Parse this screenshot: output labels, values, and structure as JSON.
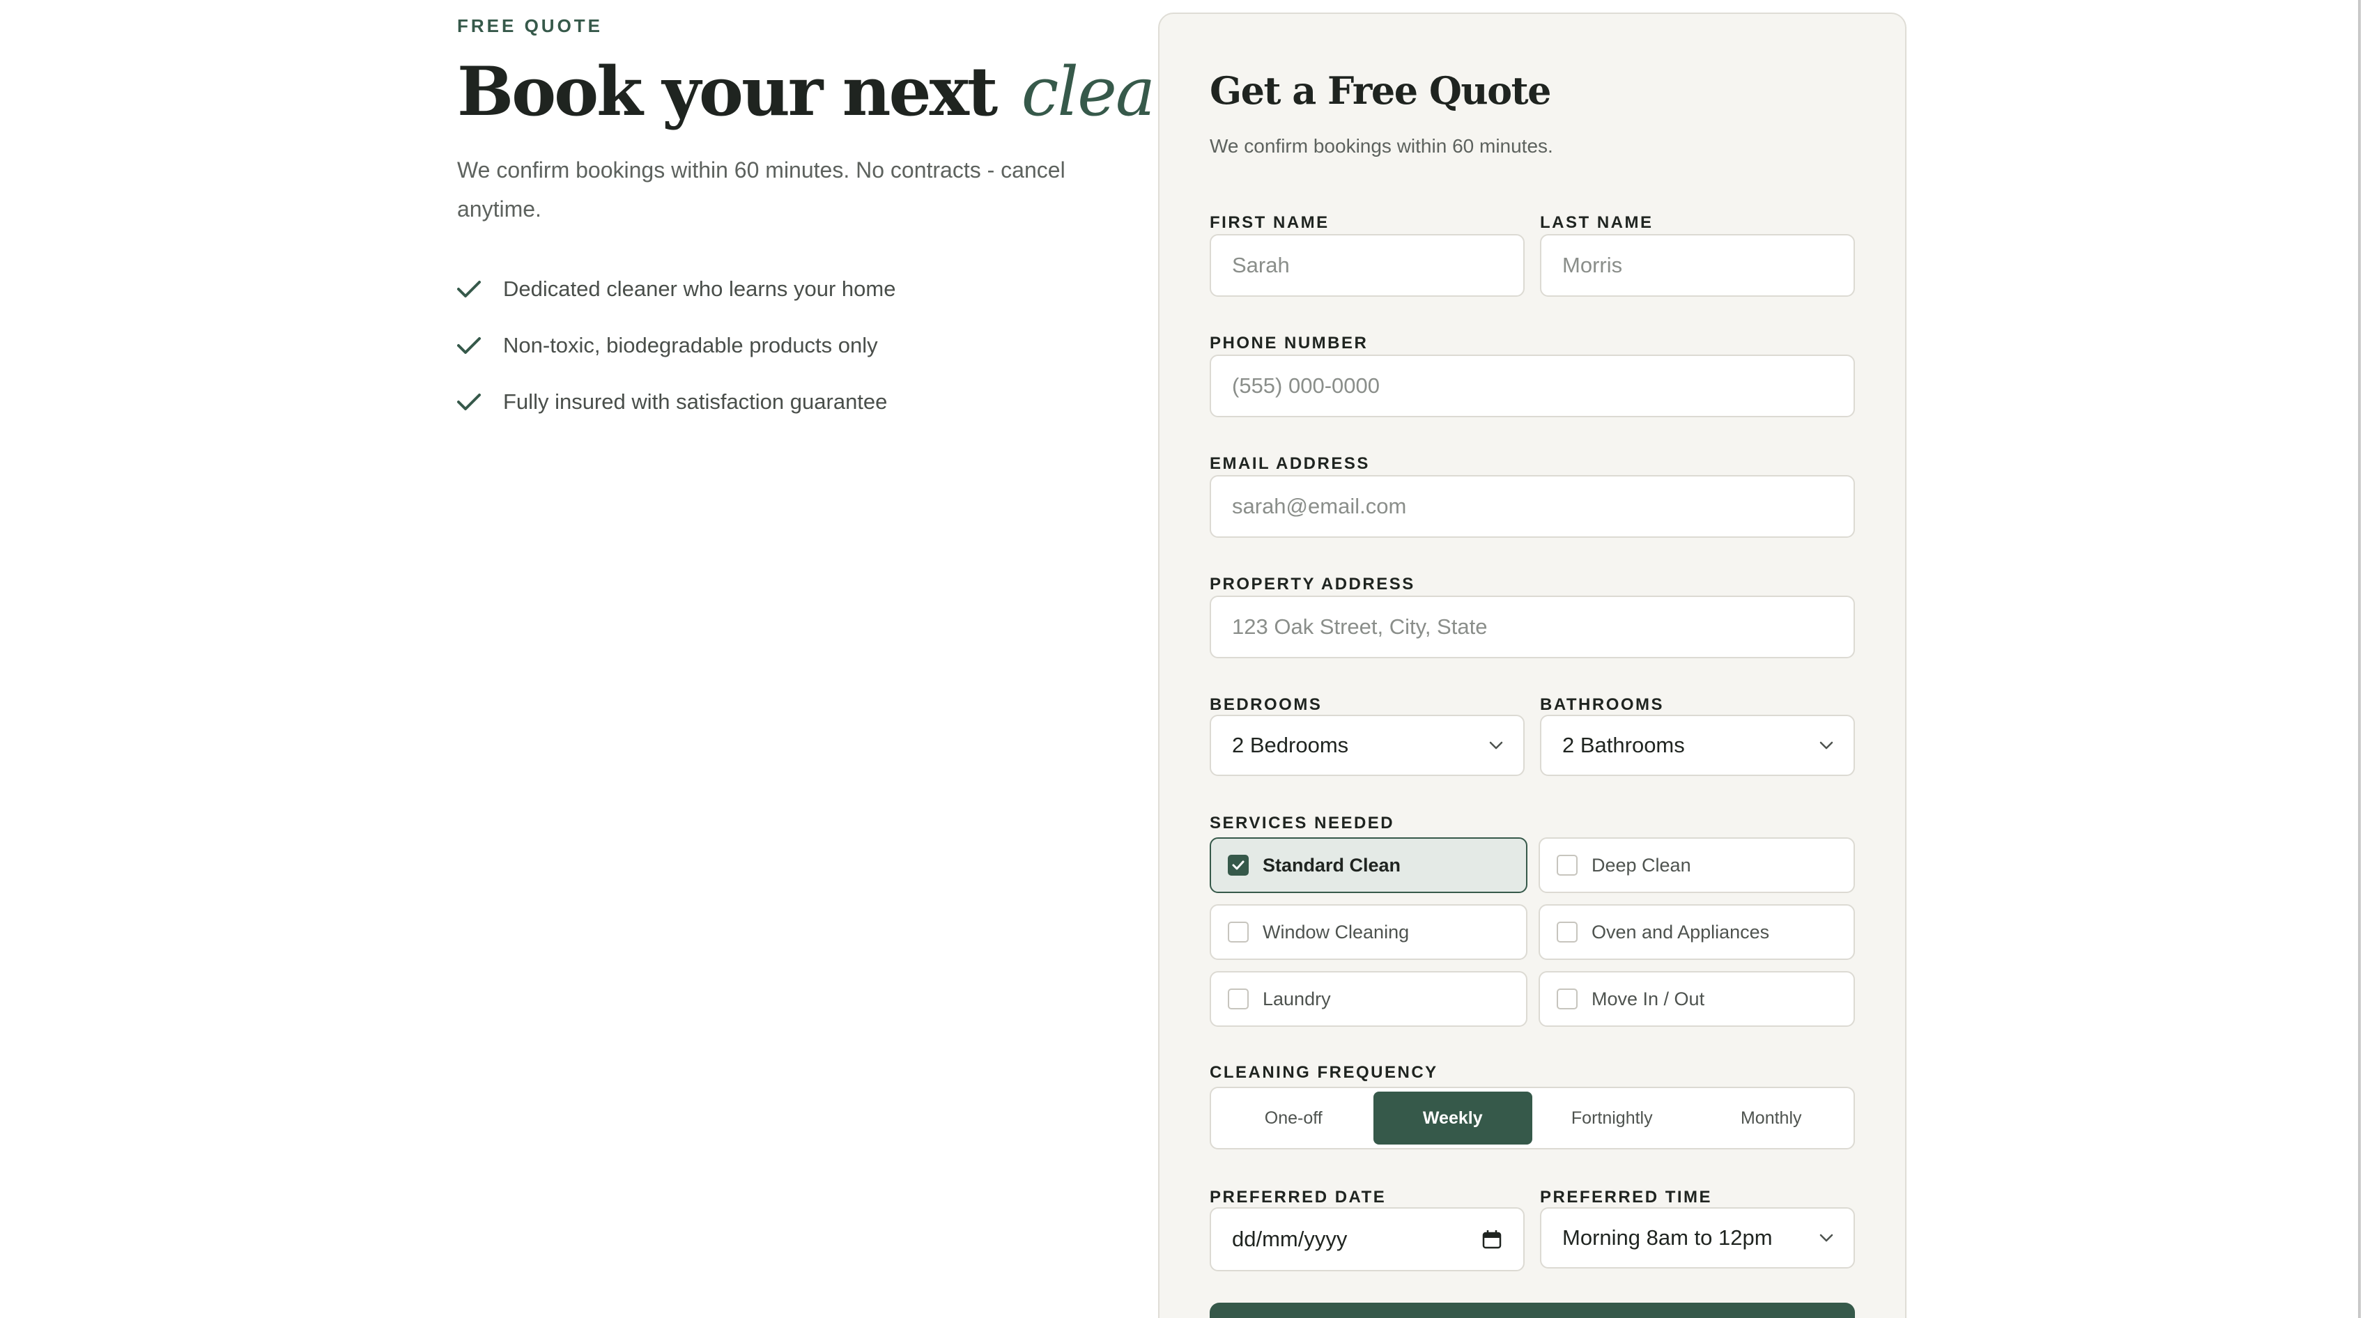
{
  "hero": {
    "eyebrow": "FREE QUOTE",
    "title_main": "Book your next",
    "title_accent": "clean",
    "subtitle": "We confirm bookings within 60 minutes. No contracts - cancel anytime.",
    "benefits": [
      "Dedicated cleaner who learns your home",
      "Non-toxic, biodegradable products only",
      "Fully insured with satisfaction guarantee"
    ]
  },
  "form": {
    "title": "Get a Free Quote",
    "subtitle": "We confirm bookings within 60 minutes.",
    "first_name": {
      "label": "FIRST NAME",
      "placeholder": "Sarah"
    },
    "last_name": {
      "label": "LAST NAME",
      "placeholder": "Morris"
    },
    "phone": {
      "label": "PHONE NUMBER",
      "placeholder": "(555) 000-0000"
    },
    "email": {
      "label": "EMAIL ADDRESS",
      "placeholder": "sarah@email.com"
    },
    "address": {
      "label": "PROPERTY ADDRESS",
      "placeholder": "123 Oak Street, City, State"
    },
    "bedrooms": {
      "label": "BEDROOMS",
      "value": "2 Bedrooms"
    },
    "bathrooms": {
      "label": "BATHROOMS",
      "value": "2 Bathrooms"
    },
    "services": {
      "label": "SERVICES NEEDED",
      "items": [
        {
          "label": "Standard Clean",
          "checked": true
        },
        {
          "label": "Deep Clean",
          "checked": false
        },
        {
          "label": "Window Cleaning",
          "checked": false
        },
        {
          "label": "Oven and Appliances",
          "checked": false
        },
        {
          "label": "Laundry",
          "checked": false
        },
        {
          "label": "Move In / Out",
          "checked": false
        }
      ]
    },
    "frequency": {
      "label": "CLEANING FREQUENCY",
      "options": [
        "One-off",
        "Weekly",
        "Fortnightly",
        "Monthly"
      ],
      "selected": "Weekly"
    },
    "date": {
      "label": "PREFERRED DATE",
      "placeholder": "dd/mm/yyyy"
    },
    "time": {
      "label": "PREFERRED TIME",
      "value": "Morning 8am to 12pm"
    }
  },
  "colors": {
    "accent": "#36594a",
    "card_bg": "#f6f5f1",
    "text": "#1f2420",
    "muted": "#5d625e"
  },
  "icons": {
    "benefit": "check-icon",
    "select": "chevron-down-icon",
    "date": "calendar-icon",
    "checkbox_checked": "checkmark-icon"
  }
}
